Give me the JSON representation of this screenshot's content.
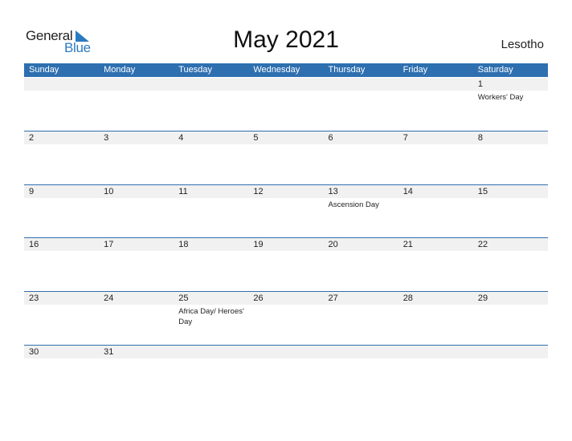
{
  "logo": {
    "general": "General",
    "blue": "Blue",
    "icon": "triangle-flag-icon",
    "brand_color": "#2a7ac0"
  },
  "title": "May 2021",
  "country": "Lesotho",
  "header_color": "#2e6fb0",
  "weekdays": [
    "Sunday",
    "Monday",
    "Tuesday",
    "Wednesday",
    "Thursday",
    "Friday",
    "Saturday"
  ],
  "weeks": [
    [
      {
        "day": ""
      },
      {
        "day": ""
      },
      {
        "day": ""
      },
      {
        "day": ""
      },
      {
        "day": ""
      },
      {
        "day": ""
      },
      {
        "day": "1",
        "holiday": "Workers' Day"
      }
    ],
    [
      {
        "day": "2"
      },
      {
        "day": "3"
      },
      {
        "day": "4"
      },
      {
        "day": "5"
      },
      {
        "day": "6"
      },
      {
        "day": "7"
      },
      {
        "day": "8"
      }
    ],
    [
      {
        "day": "9"
      },
      {
        "day": "10"
      },
      {
        "day": "11"
      },
      {
        "day": "12"
      },
      {
        "day": "13",
        "holiday": "Ascension Day"
      },
      {
        "day": "14"
      },
      {
        "day": "15"
      }
    ],
    [
      {
        "day": "16"
      },
      {
        "day": "17"
      },
      {
        "day": "18"
      },
      {
        "day": "19"
      },
      {
        "day": "20"
      },
      {
        "day": "21"
      },
      {
        "day": "22"
      }
    ],
    [
      {
        "day": "23"
      },
      {
        "day": "24"
      },
      {
        "day": "25",
        "holiday": "Africa Day/ Heroes' Day"
      },
      {
        "day": "26"
      },
      {
        "day": "27"
      },
      {
        "day": "28"
      },
      {
        "day": "29"
      }
    ],
    [
      {
        "day": "30"
      },
      {
        "day": "31"
      },
      {
        "day": ""
      },
      {
        "day": ""
      },
      {
        "day": ""
      },
      {
        "day": ""
      },
      {
        "day": ""
      }
    ]
  ]
}
